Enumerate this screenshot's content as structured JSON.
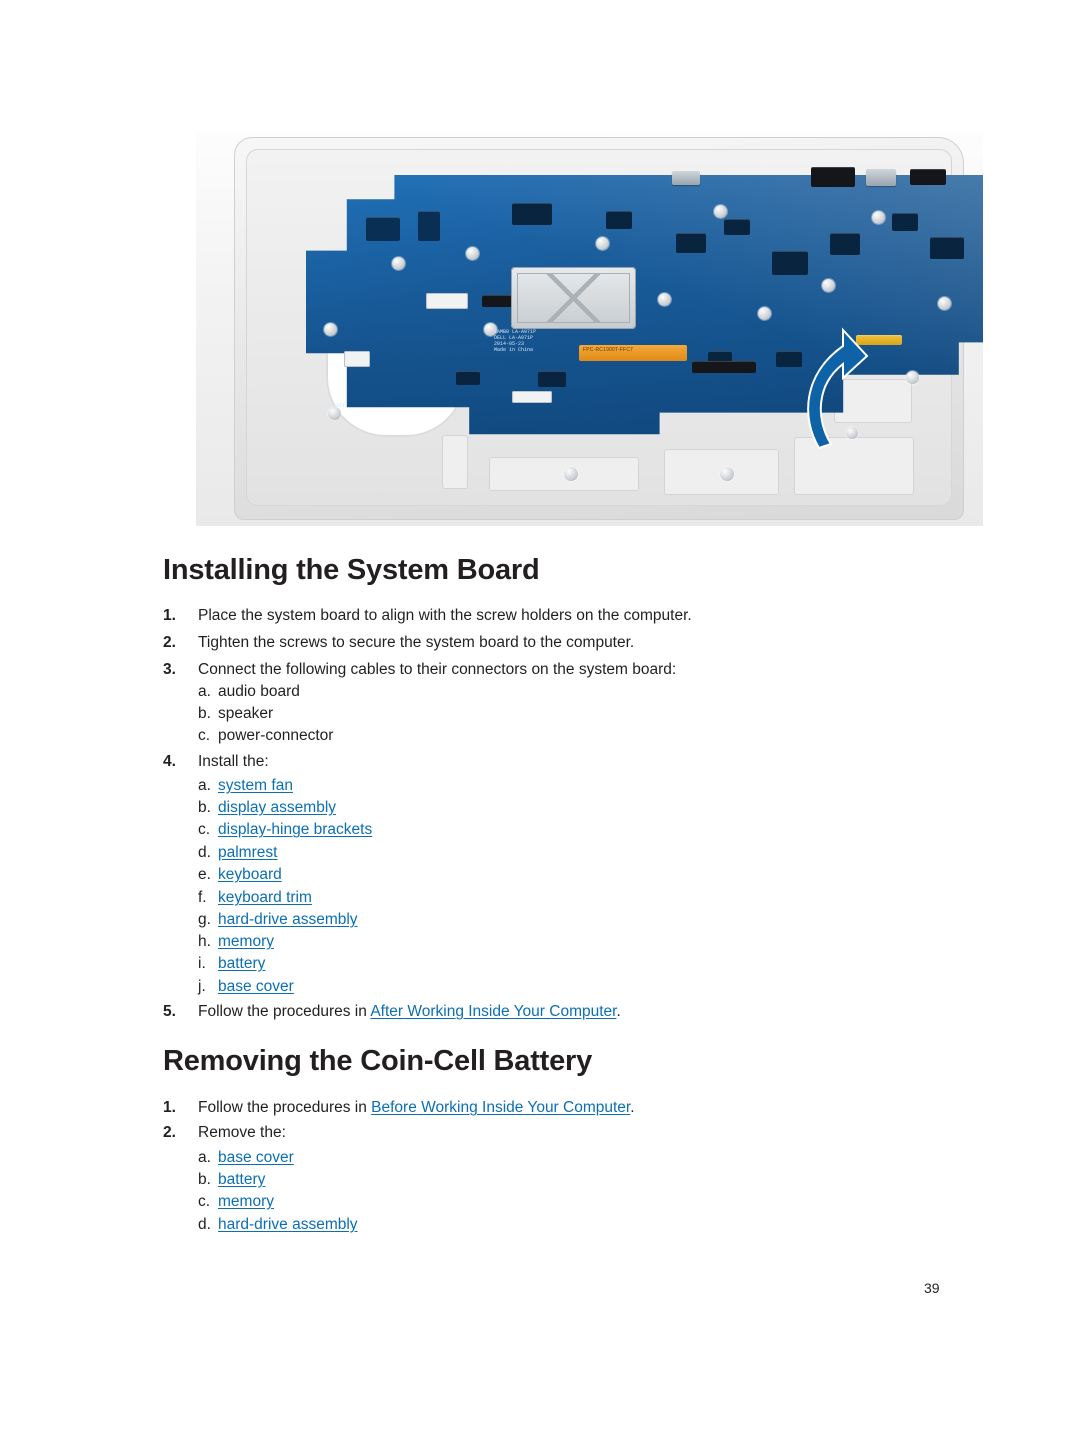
{
  "document": {
    "page_number": "39",
    "figure": {
      "caption_alt": "system-board-removal-illustration",
      "board_labels": [
        "ZAMB0 LA-A971P",
        "DELL LA-A971P",
        "2014-05-23",
        "Made in China",
        "LA-A971P",
        "LA-A971"
      ],
      "cable_label": "FPC-RC1900T-FFC7"
    },
    "sections": [
      {
        "id": "installing-system-board",
        "title": "Installing the System Board",
        "steps": [
          {
            "num": "1.",
            "text": "Place the system board to align with the screw holders on the computer."
          },
          {
            "num": "2.",
            "text": "Tighten the screws to secure the system board to the computer."
          },
          {
            "num": "3.",
            "text": "Connect the following cables to their connectors on the system board:",
            "sub": [
              {
                "letter": "a.",
                "text": "audio board",
                "link": false
              },
              {
                "letter": "b.",
                "text": "speaker",
                "link": false
              },
              {
                "letter": "c.",
                "text": "power-connector",
                "link": false
              }
            ]
          },
          {
            "num": "4.",
            "text": "Install the:",
            "sub": [
              {
                "letter": "a.",
                "text": "system fan",
                "link": true
              },
              {
                "letter": "b.",
                "text": "display assembly",
                "link": true
              },
              {
                "letter": "c.",
                "text": "display-hinge brackets",
                "link": true
              },
              {
                "letter": "d.",
                "text": "palmrest",
                "link": true
              },
              {
                "letter": "e.",
                "text": "keyboard",
                "link": true
              },
              {
                "letter": "f.",
                "text": "keyboard trim",
                "link": true
              },
              {
                "letter": "g.",
                "text": "hard-drive assembly",
                "link": true
              },
              {
                "letter": "h.",
                "text": "memory",
                "link": true
              },
              {
                "letter": "i.",
                "text": "battery",
                "link": true
              },
              {
                "letter": "j.",
                "text": "base cover",
                "link": true
              }
            ]
          },
          {
            "num": "5.",
            "text_before": "Follow the procedures in ",
            "link_text": "After Working Inside Your Computer",
            "text_after": "."
          }
        ]
      },
      {
        "id": "removing-coin-cell-battery",
        "title": "Removing the Coin-Cell Battery",
        "steps": [
          {
            "num": "1.",
            "text_before": "Follow the procedures in ",
            "link_text": "Before Working Inside Your Computer",
            "text_after": "."
          },
          {
            "num": "2.",
            "text": "Remove the:",
            "sub": [
              {
                "letter": "a.",
                "text": "base cover",
                "link": true
              },
              {
                "letter": "b.",
                "text": "battery",
                "link": true
              },
              {
                "letter": "c.",
                "text": "memory",
                "link": true
              },
              {
                "letter": "d.",
                "text": "hard-drive assembly",
                "link": true
              }
            ]
          }
        ]
      }
    ],
    "colors": {
      "link": "#0a6fb5",
      "text": "#231f20",
      "pcb_blue": "#155a9b"
    }
  }
}
